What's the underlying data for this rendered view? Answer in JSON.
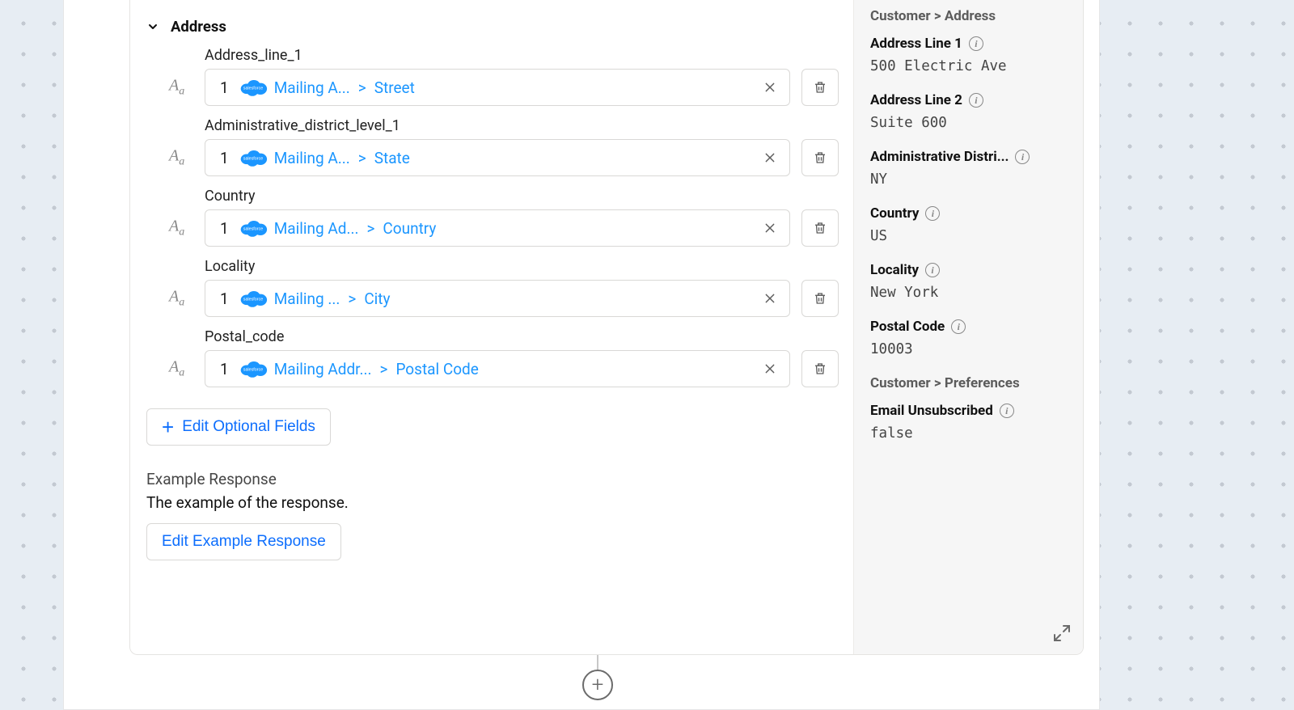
{
  "section": {
    "title": "Address",
    "fields": [
      {
        "label": "Address_line_1",
        "num": "1",
        "source": "Mailing A...",
        "target": "Street"
      },
      {
        "label": "Administrative_district_level_1",
        "num": "1",
        "source": "Mailing A...",
        "target": "State"
      },
      {
        "label": "Country",
        "num": "1",
        "source": "Mailing Ad...",
        "target": "Country"
      },
      {
        "label": "Locality",
        "num": "1",
        "source": "Mailing ...",
        "target": "City"
      },
      {
        "label": "Postal_code",
        "num": "1",
        "source": "Mailing Addr...",
        "target": "Postal Code"
      }
    ]
  },
  "buttons": {
    "editOptional": "Edit Optional Fields",
    "editExample": "Edit Example Response"
  },
  "example": {
    "heading": "Example Response",
    "desc": "The example of the response."
  },
  "preview": {
    "crumb1": "Customer > Address",
    "crumb2": "Customer > Preferences",
    "items": [
      {
        "label": "Address Line 1",
        "value": "500 Electric Ave"
      },
      {
        "label": "Address Line 2",
        "value": "Suite 600"
      },
      {
        "label": "Administrative Distri...",
        "value": "NY"
      },
      {
        "label": "Country",
        "value": "US"
      },
      {
        "label": "Locality",
        "value": "New York"
      },
      {
        "label": "Postal Code",
        "value": "10003"
      }
    ],
    "pref": {
      "label": "Email Unsubscribed",
      "value": "false"
    }
  }
}
